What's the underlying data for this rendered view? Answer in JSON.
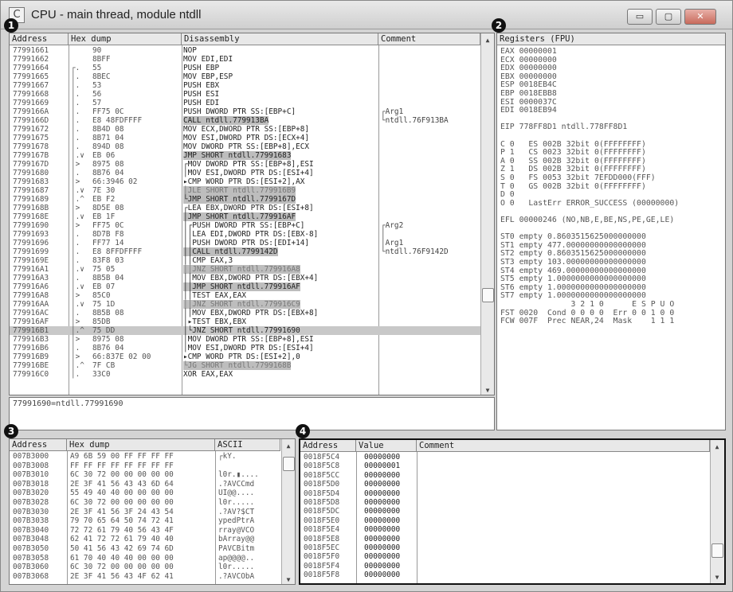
{
  "window": {
    "title": "CPU - main thread, module ntdll",
    "icon": "C",
    "min": "▭",
    "max": "▢",
    "close": "✕"
  },
  "badges": [
    "1",
    "2",
    "3",
    "4"
  ],
  "cpu": {
    "headers": [
      "Address",
      "Hex dump",
      "Disassembly",
      "Comment"
    ],
    "rows": [
      {
        "a": "77991661",
        "m": "  ",
        "h": "90",
        "d": "NOP",
        "c": ""
      },
      {
        "a": "77991662",
        "m": "  ",
        "h": "8BFF",
        "d": "MOV EDI,EDI",
        "c": ""
      },
      {
        "a": "77991664",
        "m": "┌.",
        "h": "55",
        "d": "PUSH EBP",
        "c": ""
      },
      {
        "a": "77991665",
        "m": "│.",
        "h": "8BEC",
        "d": "MOV EBP,ESP",
        "c": ""
      },
      {
        "a": "77991667",
        "m": "│.",
        "h": "53",
        "d": "PUSH EBX",
        "c": ""
      },
      {
        "a": "77991668",
        "m": "│.",
        "h": "56",
        "d": "PUSH ESI",
        "c": ""
      },
      {
        "a": "77991669",
        "m": "│.",
        "h": "57",
        "d": "PUSH EDI",
        "c": ""
      },
      {
        "a": "7799166A",
        "m": "│.",
        "h": "FF75 0C",
        "d": "PUSH DWORD PTR SS:[EBP+C]",
        "c": "┌Arg1"
      },
      {
        "a": "7799166D",
        "m": "│.",
        "h": "E8 48FDFFFF",
        "d": "CALL ntdll.779913BA",
        "c": "└ntdll.76F913BA",
        "cls": "g"
      },
      {
        "a": "77991672",
        "m": "│.",
        "h": "8B4D 08",
        "d": "MOV ECX,DWORD PTR SS:[EBP+8]",
        "c": ""
      },
      {
        "a": "77991675",
        "m": "│.",
        "h": "8B71 04",
        "d": "MOV ESI,DWORD PTR DS:[ECX+4]",
        "c": ""
      },
      {
        "a": "77991678",
        "m": "│.",
        "h": "894D 08",
        "d": "MOV DWORD PTR SS:[EBP+8],ECX",
        "c": ""
      },
      {
        "a": "7799167B",
        "m": "│.∨",
        "h": "EB 06",
        "d": "JMP SHORT ntdll.77991683",
        "c": "",
        "cls": "g"
      },
      {
        "a": "7799167D",
        "m": "│>",
        "h": "8975 08",
        "d": "┌MOV DWORD PTR SS:[EBP+8],ESI",
        "c": ""
      },
      {
        "a": "77991680",
        "m": "│.",
        "h": "8B76 04",
        "d": "│MOV ESI,DWORD PTR DS:[ESI+4]",
        "c": ""
      },
      {
        "a": "77991683",
        "m": "│>",
        "h": "66:3946 02",
        "d": "▸CMP WORD PTR DS:[ESI+2],AX",
        "c": ""
      },
      {
        "a": "77991687",
        "m": "│.∨",
        "h": "7E 30",
        "d": "│JLE SHORT ntdll.779916B9",
        "c": "",
        "cls": "g"
      },
      {
        "a": "77991689",
        "m": "│.^",
        "h": "EB F2",
        "d": "└JMP SHORT ntdll.7799167D",
        "c": "",
        "cls": "g"
      },
      {
        "a": "7799168B",
        "m": "│>",
        "h": "8D5E 08",
        "d": "┌LEA EBX,DWORD PTR DS:[ESI+8]",
        "c": ""
      },
      {
        "a": "7799168E",
        "m": "│.∨",
        "h": "EB 1F",
        "d": "│JMP SHORT ntdll.779916AF",
        "c": "",
        "cls": "g"
      },
      {
        "a": "77991690",
        "m": "│>",
        "h": "FF75 0C",
        "d": "│┌PUSH DWORD PTR SS:[EBP+C]",
        "c": "┌Arg2"
      },
      {
        "a": "77991693",
        "m": "│.",
        "h": "8D7B F8",
        "d": "││LEA EDI,DWORD PTR DS:[EBX-8]",
        "c": "│"
      },
      {
        "a": "77991696",
        "m": "│.",
        "h": "FF77 14",
        "d": "││PUSH DWORD PTR DS:[EDI+14]",
        "c": "│Arg1"
      },
      {
        "a": "77991699",
        "m": "│.",
        "h": "E8 8FFDFFFF",
        "d": "││CALL ntdll.7799142D",
        "c": "└ntdll.76F9142D",
        "cls": "g"
      },
      {
        "a": "7799169E",
        "m": "│.",
        "h": "83F8 03",
        "d": "││CMP EAX,3",
        "c": ""
      },
      {
        "a": "779916A1",
        "m": "│.∨",
        "h": "75 05",
        "d": "││JNZ SHORT ntdll.779916A8",
        "c": "",
        "cls": "g"
      },
      {
        "a": "779916A3",
        "m": "│.",
        "h": "8B5B 04",
        "d": "││MOV EBX,DWORD PTR DS:[EBX+4]",
        "c": ""
      },
      {
        "a": "779916A6",
        "m": "│.∨",
        "h": "EB 07",
        "d": "││JMP SHORT ntdll.779916AF",
        "c": "",
        "cls": "g"
      },
      {
        "a": "779916A8",
        "m": "│>",
        "h": "85C0",
        "d": "││TEST EAX,EAX",
        "c": ""
      },
      {
        "a": "779916AA",
        "m": "│.∨",
        "h": "75 1D",
        "d": "││JNZ SHORT ntdll.779916C9",
        "c": "",
        "cls": "g"
      },
      {
        "a": "779916AC",
        "m": "│.",
        "h": "8B5B 08",
        "d": "││MOV EBX,DWORD PTR DS:[EBX+8]",
        "c": ""
      },
      {
        "a": "779916AF",
        "m": "│>",
        "h": "85DB",
        "d": "│▸TEST EBX,EBX",
        "c": ""
      },
      {
        "a": "779916B1",
        "m": "│.^",
        "h": "75 DD",
        "d": "│└JNZ SHORT ntdll.77991690",
        "c": "",
        "cls": "sel"
      },
      {
        "a": "779916B3",
        "m": "│>",
        "h": "8975 08",
        "d": "│MOV DWORD PTR SS:[EBP+8],ESI",
        "c": ""
      },
      {
        "a": "779916B6",
        "m": "│.",
        "h": "8B76 04",
        "d": "│MOV ESI,DWORD PTR DS:[ESI+4]",
        "c": ""
      },
      {
        "a": "779916B9",
        "m": "│>",
        "h": "66:837E 02 00",
        "d": "▸CMP WORD PTR DS:[ESI+2],0",
        "c": ""
      },
      {
        "a": "779916BE",
        "m": "│.^",
        "h": "7F CB",
        "d": "└JG SHORT ntdll.7799168B",
        "c": "",
        "cls": "g"
      },
      {
        "a": "779916C0",
        "m": "│.",
        "h": "33C0",
        "d": "XOR EAX,EAX",
        "c": ""
      }
    ],
    "info": "77991690=ntdll.77991690"
  },
  "registers": {
    "header": "Registers (FPU)",
    "lines": [
      "EAX 00000001",
      "ECX 00000000",
      "EDX 00000000",
      "EBX 00000000",
      "ESP 0018EB4C",
      "EBP 0018EBB8",
      "ESI 0000037C",
      "EDI 0018EB94",
      "",
      "EIP 778FF8D1 ntdll.778FF8D1",
      "",
      "C 0   ES 002B 32bit 0(FFFFFFFF)",
      "P 1   CS 0023 32bit 0(FFFFFFFF)",
      "A 0   SS 002B 32bit 0(FFFFFFFF)",
      "Z 1   DS 002B 32bit 0(FFFFFFFF)",
      "S 0   FS 0053 32bit 7EFDD000(FFF)",
      "T 0   GS 002B 32bit 0(FFFFFFFF)",
      "D 0",
      "O 0   LastErr ERROR_SUCCESS (00000000)",
      "",
      "EFL 00000246 (NO,NB,E,BE,NS,PE,GE,LE)",
      "",
      "ST0 empty 0.8603515625000000000",
      "ST1 empty 477.00000000000000000",
      "ST2 empty 0.8603515625000000000",
      "ST3 empty 103.00000000000000000",
      "ST4 empty 469.00000000000000000",
      "ST5 empty 1.0000000000000000000",
      "ST6 empty 1.0000000000000000000",
      "ST7 empty 1.0000000000000000000",
      "               3 2 1 0      E S P U O",
      "FST 0020  Cond 0 0 0 0  Err 0 0 1 0 0",
      "FCW 007F  Prec NEAR,24  Mask    1 1 1"
    ]
  },
  "dump": {
    "headers": [
      "Address",
      "Hex dump",
      "ASCII"
    ],
    "rows": [
      {
        "a": "007B3000",
        "h": "A9 6B 59 00 FF FF FF FF",
        "s": "┌kY."
      },
      {
        "a": "007B3008",
        "h": "FF FF FF FF FF FF FF FF",
        "s": ""
      },
      {
        "a": "007B3010",
        "h": "6C 30 72 00 00 00 00 00",
        "s": "l0r.▮...."
      },
      {
        "a": "007B3018",
        "h": "2E 3F 41 56 43 43 6D 64",
        "s": ".?AVCCmd"
      },
      {
        "a": "007B3020",
        "h": "55 49 40 40 00 00 00 00",
        "s": "UI@@...."
      },
      {
        "a": "007B3028",
        "h": "6C 30 72 00 00 00 00 00",
        "s": "l0r....."
      },
      {
        "a": "007B3030",
        "h": "2E 3F 41 56 3F 24 43 54",
        "s": ".?AV?$CT"
      },
      {
        "a": "007B3038",
        "h": "79 70 65 64 50 74 72 41",
        "s": "ypedPtrA"
      },
      {
        "a": "007B3040",
        "h": "72 72 61 79 40 56 43 4F",
        "s": "rray@VCO"
      },
      {
        "a": "007B3048",
        "h": "62 41 72 72 61 79 40 40",
        "s": "bArray@@"
      },
      {
        "a": "007B3050",
        "h": "50 41 56 43 42 69 74 6D",
        "s": "PAVCBitm"
      },
      {
        "a": "007B3058",
        "h": "61 70 40 40 40 00 00 00",
        "s": "ap@@@@.."
      },
      {
        "a": "007B3060",
        "h": "6C 30 72 00 00 00 00 00",
        "s": "l0r....."
      },
      {
        "a": "007B3068",
        "h": "2E 3F 41 56 43 4F 62 41",
        "s": ".?AVCObA"
      }
    ]
  },
  "stack": {
    "headers": [
      "Address",
      "Value",
      "Comment"
    ],
    "rows": [
      {
        "a": "0018F5C4",
        "v": "00000000"
      },
      {
        "a": "0018F5C8",
        "v": "00000001"
      },
      {
        "a": "0018F5CC",
        "v": "00000000"
      },
      {
        "a": "0018F5D0",
        "v": "00000000"
      },
      {
        "a": "0018F5D4",
        "v": "00000000"
      },
      {
        "a": "0018F5D8",
        "v": "00000000"
      },
      {
        "a": "0018F5DC",
        "v": "00000000"
      },
      {
        "a": "0018F5E0",
        "v": "00000000"
      },
      {
        "a": "0018F5E4",
        "v": "00000000"
      },
      {
        "a": "0018F5E8",
        "v": "00000000"
      },
      {
        "a": "0018F5EC",
        "v": "00000000"
      },
      {
        "a": "0018F5F0",
        "v": "00000000"
      },
      {
        "a": "0018F5F4",
        "v": "00000000"
      },
      {
        "a": "0018F5F8",
        "v": "00000000"
      }
    ]
  },
  "colors": {
    "selection": "#c8c8c8",
    "grey_jump": "#bdbdbd",
    "titlebar": "#d9d9d9"
  }
}
